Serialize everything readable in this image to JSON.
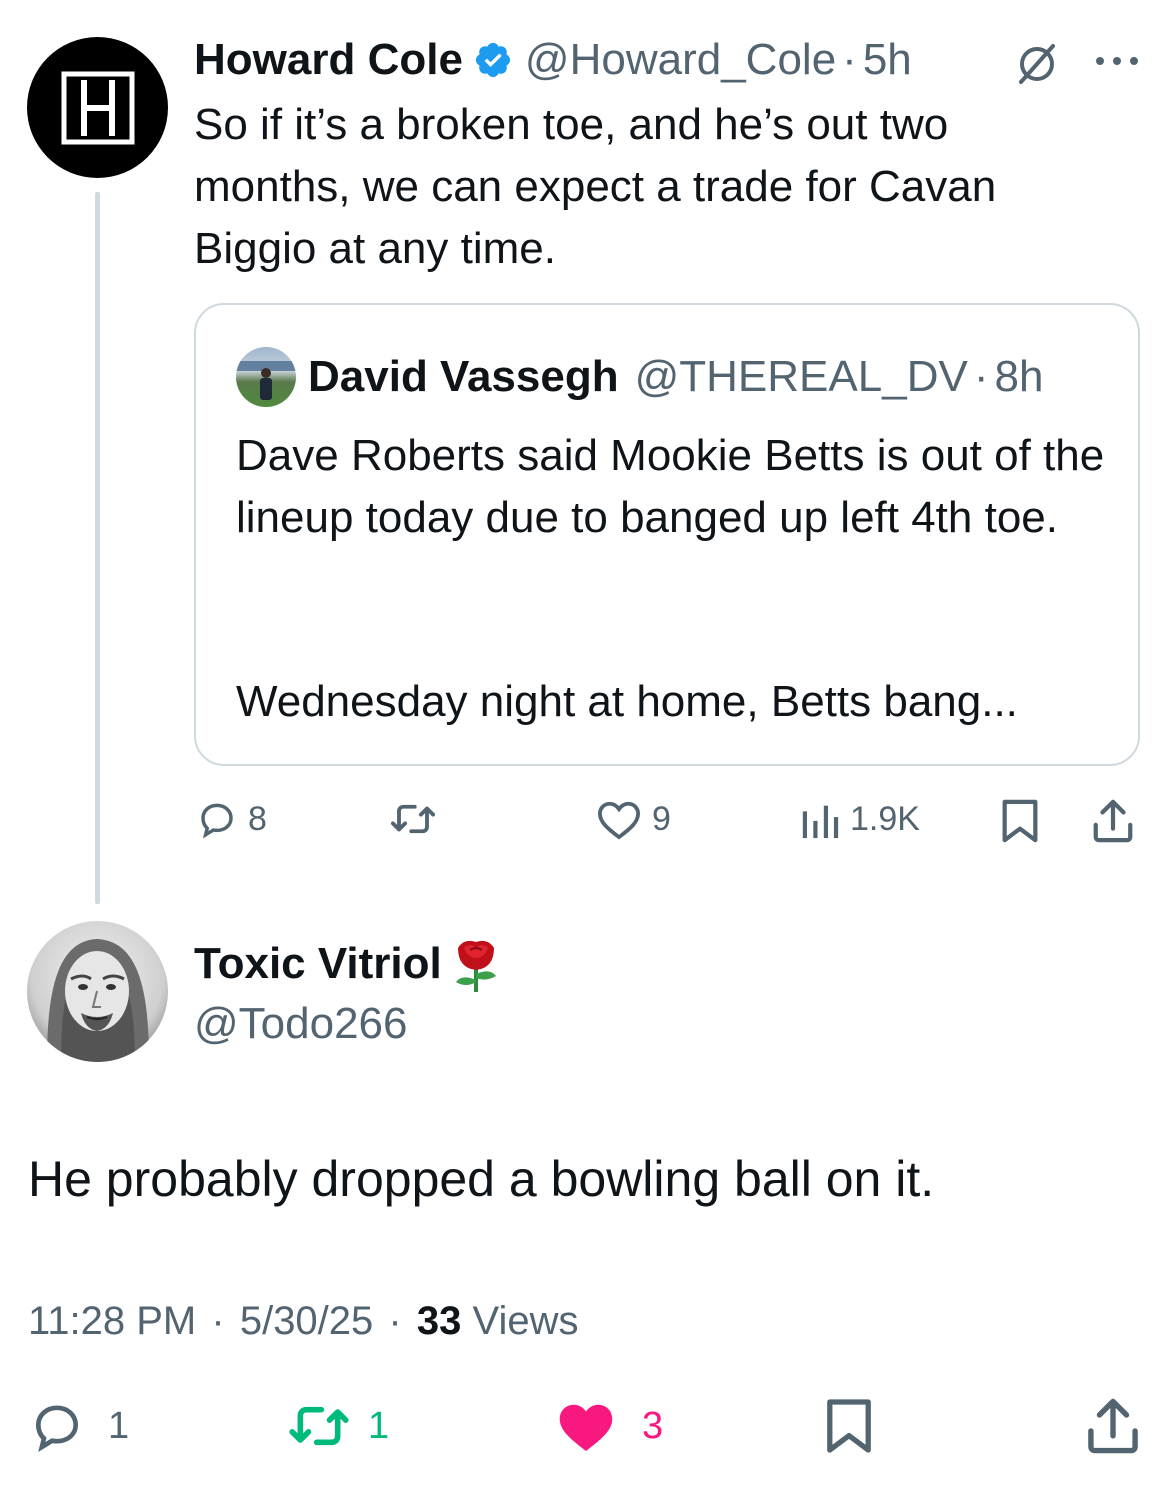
{
  "parent_tweet": {
    "avatar_letter": "H",
    "display_name": "Howard Cole",
    "verified": true,
    "handle": "@Howard_Cole",
    "dot": "·",
    "time": "5h",
    "text": "So if it’s a broken toe, and he’s out two months, we can expect a trade for Cavan Biggio at any time.",
    "quote": {
      "display_name": "David Vassegh",
      "handle": "@THEREAL_DV",
      "dot": "·",
      "time": "8h",
      "text_line1": "Dave Roberts said Mookie Betts is out of the lineup today due to banged up left 4th toe.",
      "text_line2": "Wednesday night at home, Betts bang..."
    },
    "actions": {
      "replies": "8",
      "retweets": "",
      "likes": "9",
      "views": "1.9K"
    }
  },
  "reply_tweet": {
    "display_name": "Toxic Vitriol",
    "emoji": "🌹",
    "handle": "@Todo266",
    "text": "He probably dropped a bowling ball on it.",
    "meta": {
      "time": "11:28 PM",
      "sep1": "·",
      "date": "5/30/25",
      "sep2": "·",
      "views_count": "33",
      "views_label": "Views"
    },
    "actions": {
      "replies": "1",
      "retweets": "1",
      "likes": "3"
    }
  },
  "colors": {
    "verified_blue": "#1d9bf0",
    "retweet_green": "#00ba7c",
    "like_pink": "#f91880",
    "muted": "#536471"
  }
}
